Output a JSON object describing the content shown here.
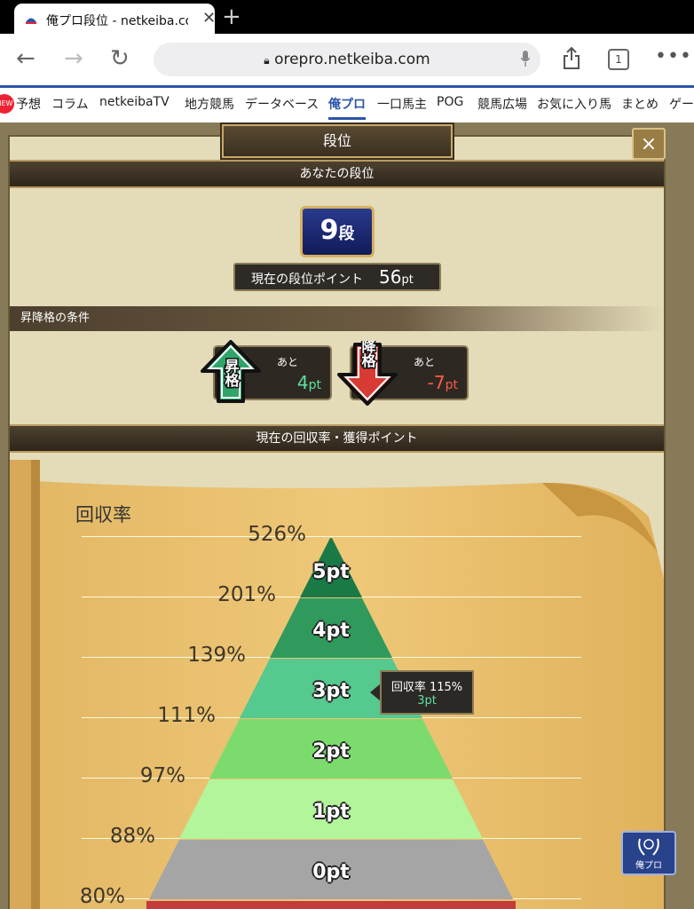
{
  "browser": {
    "tab_title": "俺プロ段位 - netkeiba.com",
    "url": "orepro.netkeiba.com",
    "tabs_count": "1"
  },
  "site_nav": {
    "new_badge": "NEW",
    "items": [
      "予想",
      "コラム",
      "netkeibaTV",
      "地方競馬",
      "データベース",
      "俺プロ",
      "一口馬主",
      "POG",
      "競馬広場",
      "お気に入り馬",
      "まとめ",
      "ゲー"
    ]
  },
  "dialog": {
    "title": "段位",
    "close_label": "×",
    "section_rank": "あなたの段位",
    "rank_number": "9",
    "rank_unit": "段",
    "current_points_label": "現在の段位ポイント",
    "current_points_value": "56",
    "current_points_unit": "pt",
    "conditions_label": "昇降格の条件",
    "promotion": {
      "icon_text": "昇格",
      "ato": "あと",
      "value": "4",
      "unit": "pt",
      "color": "#5fe0a0"
    },
    "demotion": {
      "icon_text": "降格",
      "ato": "あと",
      "value": "-7",
      "unit": "pt",
      "color": "#ff5a4a"
    },
    "section_recovery": "現在の回収率・獲得ポイント"
  },
  "chart_data": {
    "type": "table",
    "title": "回収率",
    "thresholds": [
      "526%",
      "201%",
      "139%",
      "111%",
      "97%",
      "88%",
      "80%"
    ],
    "tiers": [
      {
        "label": "5pt",
        "color": "#1a7a45"
      },
      {
        "label": "4pt",
        "color": "#2f9a5c"
      },
      {
        "label": "3pt",
        "color": "#55c98e"
      },
      {
        "label": "2pt",
        "color": "#7bdc6d"
      },
      {
        "label": "1pt",
        "color": "#b3f59a"
      },
      {
        "label": "0pt",
        "color": "#a5a5a5"
      }
    ],
    "current": {
      "label": "回収率",
      "rate": "115%",
      "points": "3pt"
    }
  },
  "float_button": {
    "label": "俺プロ"
  }
}
